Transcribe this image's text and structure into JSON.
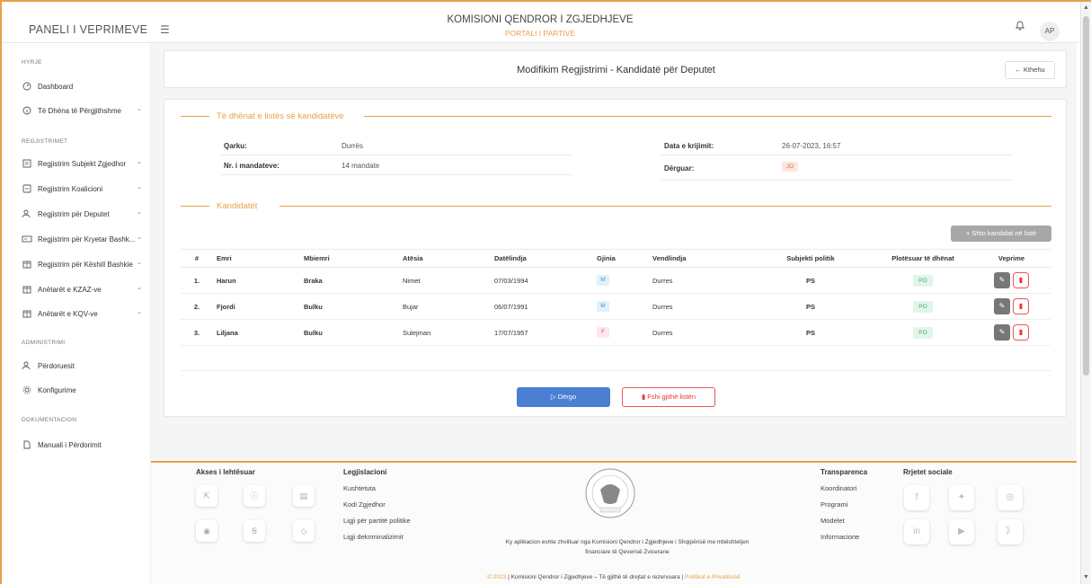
{
  "app": {
    "brand": "PANELI I VEPRIMEVE",
    "title": "KOMISIONI QENDROR I ZGJEDHJEVE",
    "subtitle": "PORTALI I PARTIVE",
    "avatar": "AP",
    "accent_color": "#e8a04a"
  },
  "sidebar": {
    "h_hyrje": "HYRJE",
    "dashboard": "Dashboard",
    "te_dhena": "Të Dhëna të Përgjithshme",
    "h_regj": "REGJISTRIMET",
    "regj_subjekt": "Regjistrim Subjekt Zgjedhor",
    "regj_koalicioni": "Regjistrim Koalicioni",
    "regj_deputet": "Regjistrim për Deputet",
    "regj_kryetar": "Regjistrim për Kryetar Bashk...",
    "regj_keshill": "Regjistrim për Këshill Bashkie",
    "kzaz": "Anëtarët e KZAZ-ve",
    "kqv": "Anëtarët e KQV-ve",
    "h_admin": "ADMINISTRIMI",
    "perdoruesit": "Përdoruesit",
    "konfigurime": "Konfigurime",
    "h_dok": "DOKUMENTACION",
    "manuali": "Manuali i Përdorimit"
  },
  "page": {
    "title": "Modifikim Regjistrimi - Kandidatë për Deputet",
    "back": "← Kthehu"
  },
  "list_info": {
    "section_title": "Të dhënat e listës së kandidatëve",
    "qarku_label": "Qarku:",
    "qarku_value": "Durrës",
    "mandate_label": "Nr. i mandateve:",
    "mandate_value": "14 mandate",
    "data_label": "Data e krijimit:",
    "data_value": "26-07-2023, 16:57",
    "derguar_label": "Dërguar:",
    "derguar_value": "JO"
  },
  "candidates": {
    "section_title": "Kandidatët",
    "add_button": "+ Shto kandidat në listë",
    "columns": [
      "#",
      "Emri",
      "Mbiemri",
      "Atësia",
      "Datëlindja",
      "Gjinia",
      "Vendlindja",
      "Subjekti politik",
      "Plotësuar të dhënat",
      "Veprime"
    ],
    "rows": [
      {
        "num": "1.",
        "emri": "Harun",
        "mbiemri": "Braka",
        "atesia": "Nimet",
        "datelindja": "07/03/1994",
        "gjinia": "M",
        "vendlindja": "Durres",
        "subjekti": "PS",
        "plotesuar": "PO"
      },
      {
        "num": "2.",
        "emri": "Fjordi",
        "mbiemri": "Bulku",
        "atesia": "Bujar",
        "datelindja": "06/07/1991",
        "gjinia": "M",
        "vendlindja": "Durres",
        "subjekti": "PS",
        "plotesuar": "PO"
      },
      {
        "num": "3.",
        "emri": "Liljana",
        "mbiemri": "Bulku",
        "atesia": "Sulejman",
        "datelindja": "17/07/1957",
        "gjinia": "F",
        "vendlindja": "Durres",
        "subjekti": "PS",
        "plotesuar": "PO"
      }
    ]
  },
  "actions": {
    "send": "▷ Dërgo",
    "delete_all": "Fshi gjithë listën"
  },
  "footer": {
    "akses_title": "Akses i lehtësuar",
    "leg_title": "Legjislacioni",
    "leg_items": [
      "Kushtetuta",
      "Kodi Zgjedhor",
      "Ligji për partitë politike",
      "Ligji dekriminalizimit"
    ],
    "trans_title": "Transparenca",
    "trans_items": [
      "Koordinatori",
      "Programi",
      "Modelet",
      "Informacione"
    ],
    "social_title": "Rrjetet sociale",
    "center_line1": "Ky aplikacion eshte zhvilluar nga Komisioni Qendror i Zgjedhjeve i Shqipërisë me mbështetjen",
    "center_line2": "financiare të Qeverisë Zvicerane",
    "copyright_year": "© 2023",
    "copyright_text": "| Komisioni Qendror i Zgjedhjeve – Të gjithë të drejtat e rezervuara |",
    "copyright_link": "Politikat e Privatësisë"
  }
}
